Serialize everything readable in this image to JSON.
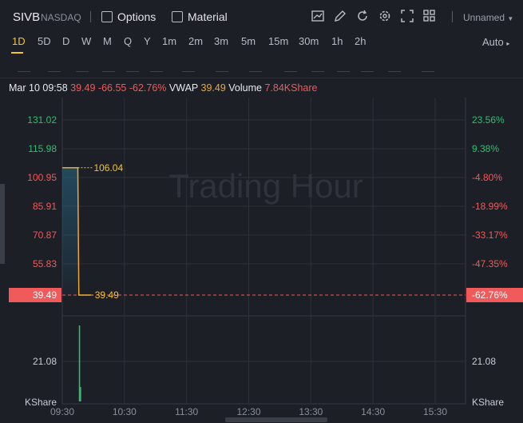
{
  "header": {
    "ticker": "SIVB",
    "exchange": "NASDAQ",
    "options_label": "Options",
    "material_label": "Material",
    "layout_name": "Unnamed"
  },
  "periods": [
    "1D",
    "5D",
    "D",
    "W",
    "M",
    "Q",
    "Y",
    "1m",
    "2m",
    "3m",
    "5m",
    "15m",
    "30m",
    "1h",
    "2h"
  ],
  "active_period": "1D",
  "scale_mode": "Auto",
  "quote": {
    "datetime": "Mar 10 09:58",
    "price": "39.49",
    "change": "-66.55",
    "change_pct": "-62.76%",
    "vwap_label": "VWAP",
    "vwap_value": "39.49",
    "volume_label": "Volume",
    "volume_value": "7.84KShare"
  },
  "watermark": "Trading Hour",
  "colors": {
    "up": "#2fbf71",
    "down": "#f05a5a",
    "accent": "#f2c530",
    "price_line": "#f2a532"
  },
  "chart_data": {
    "type": "line",
    "x": [
      "09:30",
      "09:45",
      "09:46",
      "09:58"
    ],
    "price": [
      106.04,
      106.04,
      39.49,
      39.49
    ],
    "prev_close": 106.04,
    "current_price": 39.49,
    "annotations": [
      {
        "label": "106.04",
        "value": 106.04
      },
      {
        "label": "39.49",
        "value": 39.49
      }
    ],
    "y_ticks": [
      "131.02",
      "115.98",
      "100.95",
      "85.91",
      "70.87",
      "55.83",
      "39.49"
    ],
    "y_ticks_right": [
      "23.56%",
      "9.38%",
      "-4.80%",
      "-18.99%",
      "-33.17%",
      "-47.35%",
      "-62.76%"
    ],
    "ylim": [
      39.49,
      131.02
    ],
    "x_ticks": [
      "09:30",
      "10:30",
      "11:30",
      "12:30",
      "13:30",
      "14:30",
      "15:30"
    ],
    "volume": {
      "label": "KShare",
      "tick": "21.08",
      "bars": [
        {
          "x": "09:46",
          "value": 21.08
        },
        {
          "x": "09:47",
          "value": 4.0
        }
      ]
    }
  }
}
